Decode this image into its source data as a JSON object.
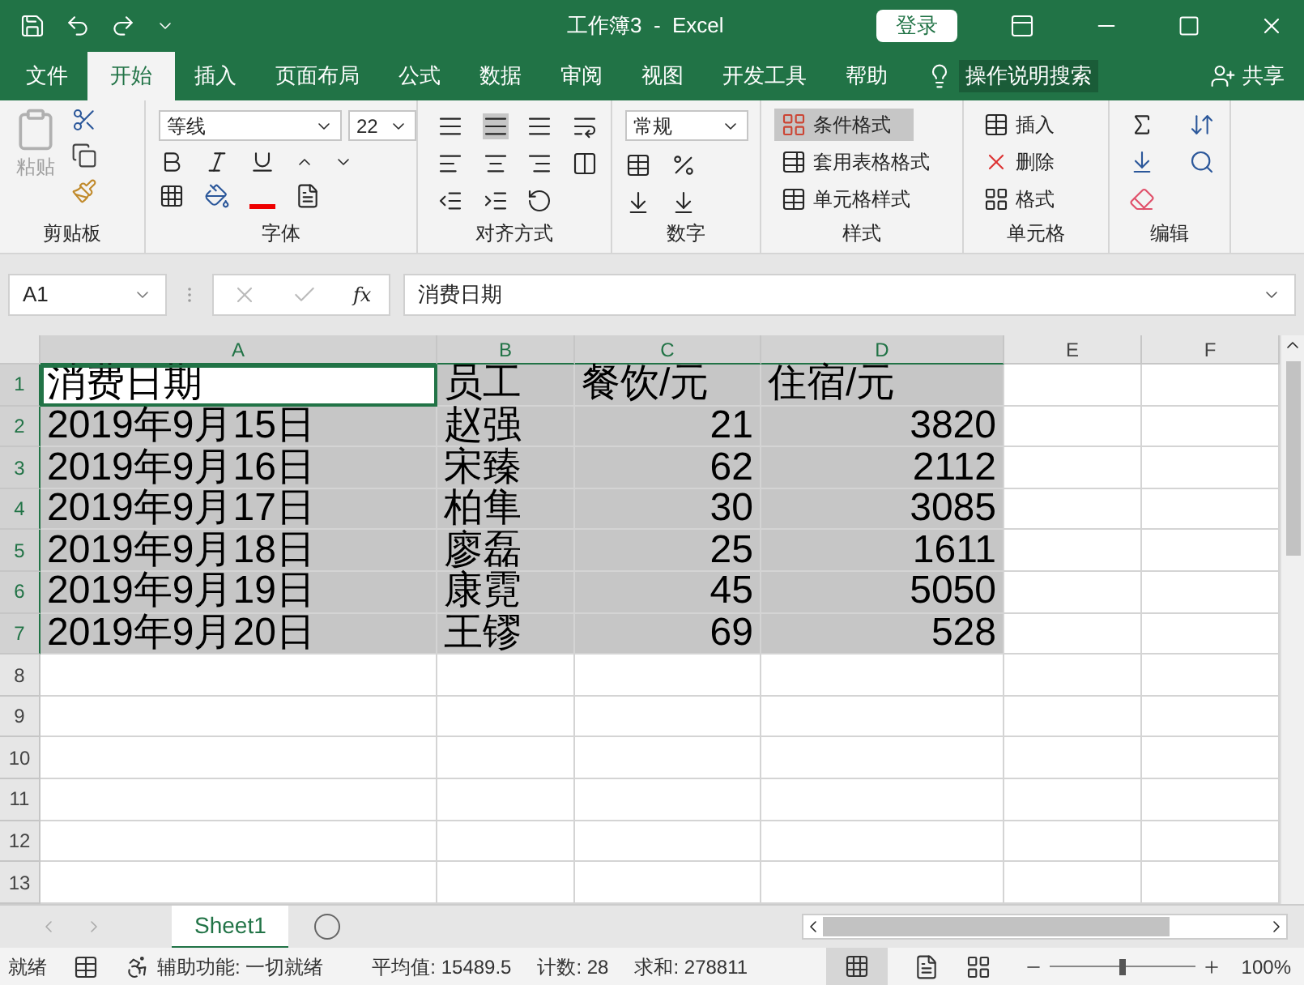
{
  "window": {
    "title": "工作簿3  -  Excel",
    "login": "登录"
  },
  "tabs": [
    {
      "label": "文件",
      "selected": false
    },
    {
      "label": "开始",
      "selected": true
    },
    {
      "label": "插入",
      "selected": false
    },
    {
      "label": "页面布局",
      "selected": false
    },
    {
      "label": "公式",
      "selected": false
    },
    {
      "label": "数据",
      "selected": false
    },
    {
      "label": "审阅",
      "selected": false
    },
    {
      "label": "视图",
      "selected": false
    },
    {
      "label": "开发工具",
      "selected": false
    },
    {
      "label": "帮助",
      "selected": false
    }
  ],
  "tell_me": "操作说明搜索",
  "share": "共享",
  "ribbon": {
    "paste": "粘贴",
    "font_name": "等线",
    "font_size": "22",
    "number_format": "常规",
    "conditional_format": "条件格式",
    "table_format": "套用表格格式",
    "cell_style": "单元格样式",
    "insert": "插入",
    "delete": "删除",
    "format": "格式",
    "groups": [
      "剪贴板",
      "字体",
      "对齐方式",
      "数字",
      "样式",
      "单元格",
      "编辑"
    ]
  },
  "name_box": "A1",
  "function_label": "fx",
  "formula": "消费日期",
  "columns": [
    {
      "label": "A",
      "selected": true
    },
    {
      "label": "B",
      "selected": true
    },
    {
      "label": "C",
      "selected": true
    },
    {
      "label": "D",
      "selected": true
    },
    {
      "label": "E",
      "selected": false
    },
    {
      "label": "F",
      "selected": false
    }
  ],
  "rows": [
    {
      "header": "1",
      "selected": true,
      "cells": [
        {
          "text": "消费日期",
          "kind": "text",
          "active": true
        },
        {
          "text": "员工",
          "kind": "text",
          "active": false
        },
        {
          "text": "餐饮/元",
          "kind": "text",
          "active": false
        },
        {
          "text": "住宿/元",
          "kind": "text",
          "active": false
        }
      ]
    },
    {
      "header": "2",
      "selected": true,
      "cells": [
        {
          "text": "2019年9月15日",
          "kind": "text",
          "active": false
        },
        {
          "text": "赵强",
          "kind": "text",
          "active": false
        },
        {
          "text": "21",
          "kind": "number",
          "active": false
        },
        {
          "text": "3820",
          "kind": "number",
          "active": false
        }
      ]
    },
    {
      "header": "3",
      "selected": true,
      "cells": [
        {
          "text": "2019年9月16日",
          "kind": "text",
          "active": false
        },
        {
          "text": "宋臻",
          "kind": "text",
          "active": false
        },
        {
          "text": "62",
          "kind": "number",
          "active": false
        },
        {
          "text": "2112",
          "kind": "number",
          "active": false
        }
      ]
    },
    {
      "header": "4",
      "selected": true,
      "cells": [
        {
          "text": "2019年9月17日",
          "kind": "text",
          "active": false
        },
        {
          "text": "柏隼",
          "kind": "text",
          "active": false
        },
        {
          "text": "30",
          "kind": "number",
          "active": false
        },
        {
          "text": "3085",
          "kind": "number",
          "active": false
        }
      ]
    },
    {
      "header": "5",
      "selected": true,
      "cells": [
        {
          "text": "2019年9月18日",
          "kind": "text",
          "active": false
        },
        {
          "text": "廖磊",
          "kind": "text",
          "active": false
        },
        {
          "text": "25",
          "kind": "number",
          "active": false
        },
        {
          "text": "1611",
          "kind": "number",
          "active": false
        }
      ]
    },
    {
      "header": "6",
      "selected": true,
      "cells": [
        {
          "text": "2019年9月19日",
          "kind": "text",
          "active": false
        },
        {
          "text": "康霓",
          "kind": "text",
          "active": false
        },
        {
          "text": "45",
          "kind": "number",
          "active": false
        },
        {
          "text": "5050",
          "kind": "number",
          "active": false
        }
      ]
    },
    {
      "header": "7",
      "selected": true,
      "cells": [
        {
          "text": "2019年9月20日",
          "kind": "text",
          "active": false
        },
        {
          "text": "王镠",
          "kind": "text",
          "active": false
        },
        {
          "text": "69",
          "kind": "number",
          "active": false
        },
        {
          "text": "528",
          "kind": "number",
          "active": false
        }
      ]
    },
    {
      "header": "8",
      "selected": false,
      "cells": []
    },
    {
      "header": "9",
      "selected": false,
      "cells": []
    },
    {
      "header": "10",
      "selected": false,
      "cells": []
    },
    {
      "header": "11",
      "selected": false,
      "cells": []
    },
    {
      "header": "12",
      "selected": false,
      "cells": []
    },
    {
      "header": "13",
      "selected": false,
      "cells": []
    }
  ],
  "sheets": [
    {
      "label": "Sheet1",
      "selected": true
    }
  ],
  "status_bar": {
    "ready": "就绪",
    "accessibility": "辅助功能: 一切就绪",
    "average": "平均值: 15489.5",
    "count": "计数: 28",
    "sum": "求和: 278811",
    "zoom": "100%",
    "zoom_slider": {
      "level": 0.5
    }
  }
}
